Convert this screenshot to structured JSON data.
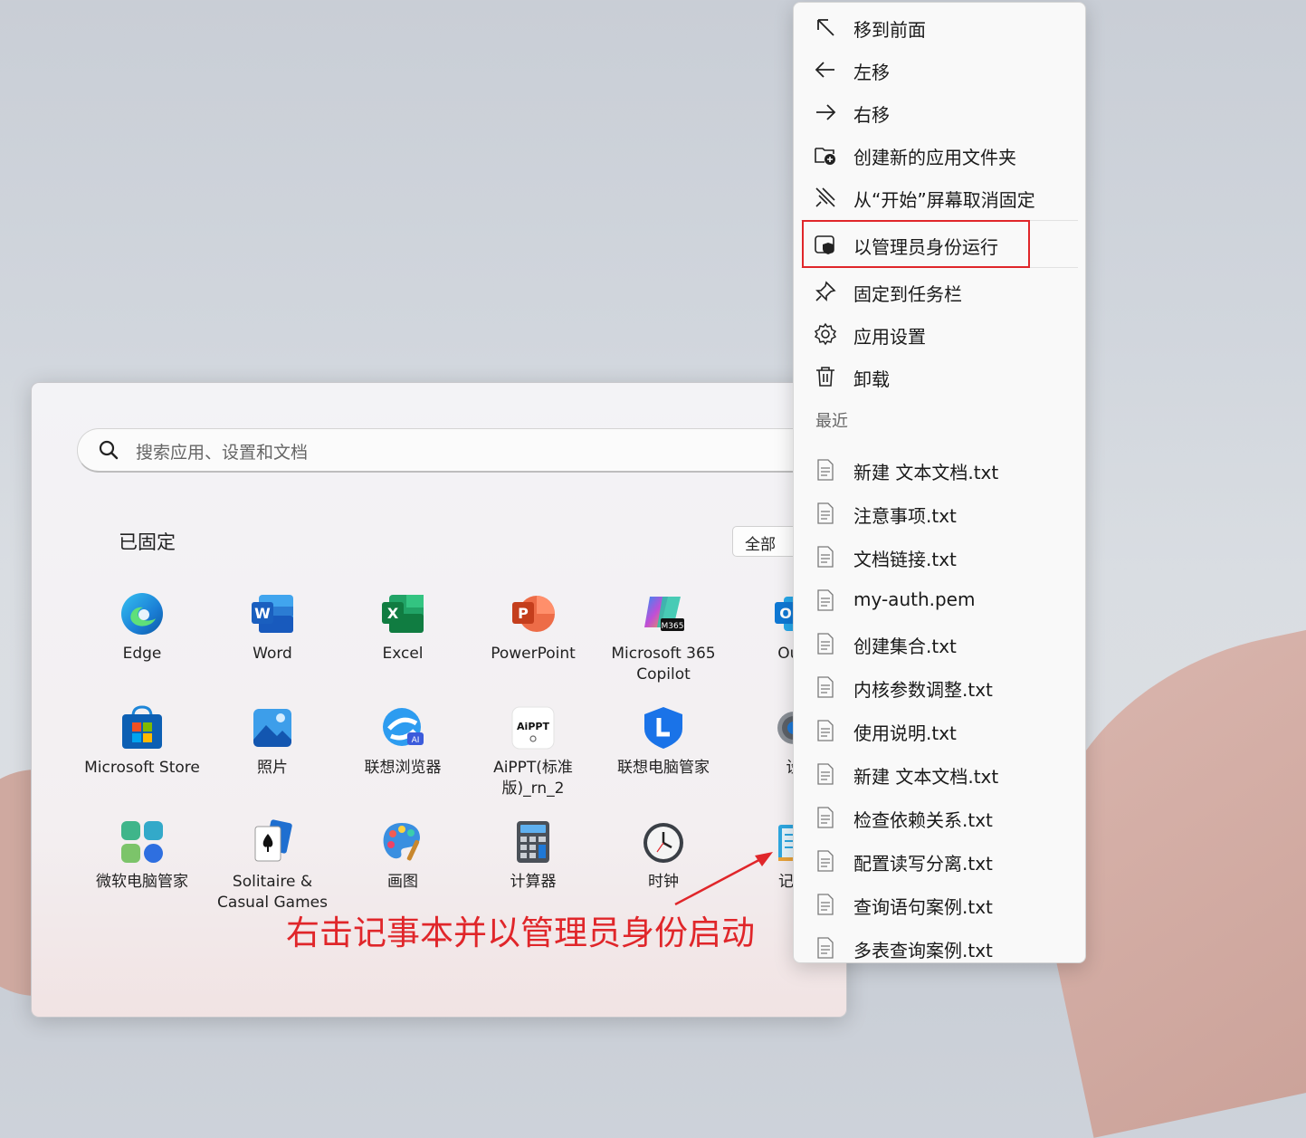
{
  "search": {
    "placeholder": "搜索应用、设置和文档"
  },
  "pinned": {
    "title": "已固定",
    "all_button": "全部",
    "apps": [
      {
        "label": "Edge",
        "icon": "edge-icon"
      },
      {
        "label": "Word",
        "icon": "word-icon"
      },
      {
        "label": "Excel",
        "icon": "excel-icon"
      },
      {
        "label": "PowerPoint",
        "icon": "powerpoint-icon"
      },
      {
        "label": "Microsoft 365\nCopilot",
        "icon": "m365-copilot-icon"
      },
      {
        "label": "Outl",
        "icon": "outlook-icon"
      },
      {
        "label": "Microsoft Store",
        "icon": "store-icon"
      },
      {
        "label": "照片",
        "icon": "photos-icon"
      },
      {
        "label": "联想浏览器",
        "icon": "lenovo-browser-icon"
      },
      {
        "label": "AiPPT(标准\n版)_rn_2",
        "icon": "aippt-icon"
      },
      {
        "label": "联想电脑管家",
        "icon": "lenovo-manager-icon"
      },
      {
        "label": "设",
        "icon": "settings-icon"
      },
      {
        "label": "微软电脑管家",
        "icon": "pc-manager-icon"
      },
      {
        "label": "Solitaire &\nCasual Games",
        "icon": "solitaire-icon"
      },
      {
        "label": "画图",
        "icon": "paint-icon"
      },
      {
        "label": "计算器",
        "icon": "calculator-icon"
      },
      {
        "label": "时钟",
        "icon": "clock-icon"
      },
      {
        "label": "记事",
        "icon": "notepad-icon"
      }
    ],
    "aippt_badge": "AiPPT",
    "m365_badge": "M365",
    "ai_badge": "AI"
  },
  "context_menu": {
    "items": [
      {
        "label": "移到前面",
        "icon": "arrow-up-left-icon"
      },
      {
        "label": "左移",
        "icon": "arrow-left-icon"
      },
      {
        "label": "右移",
        "icon": "arrow-right-icon"
      },
      {
        "label": "创建新的应用文件夹",
        "icon": "new-folder-icon"
      },
      {
        "label": "从“开始”屏幕取消固定",
        "icon": "unpin-icon"
      },
      {
        "label": "以管理员身份运行",
        "icon": "shield-icon"
      },
      {
        "label": "固定到任务栏",
        "icon": "pin-icon"
      },
      {
        "label": "应用设置",
        "icon": "gear-icon"
      },
      {
        "label": "卸载",
        "icon": "trash-icon"
      }
    ],
    "recent_title": "最近",
    "recent_files": [
      "新建 文本文档.txt",
      "注意事项.txt",
      "文档链接.txt",
      "my-auth.pem",
      "创建集合.txt",
      "内核参数调整.txt",
      "使用说明.txt",
      "新建 文本文档.txt",
      "检查依赖关系.txt",
      "配置读写分离.txt",
      "查询语句案例.txt",
      "多表查询案例.txt"
    ]
  },
  "annotation": {
    "text": "右击记事本并以管理员身份启动",
    "color": "#e0262a"
  }
}
